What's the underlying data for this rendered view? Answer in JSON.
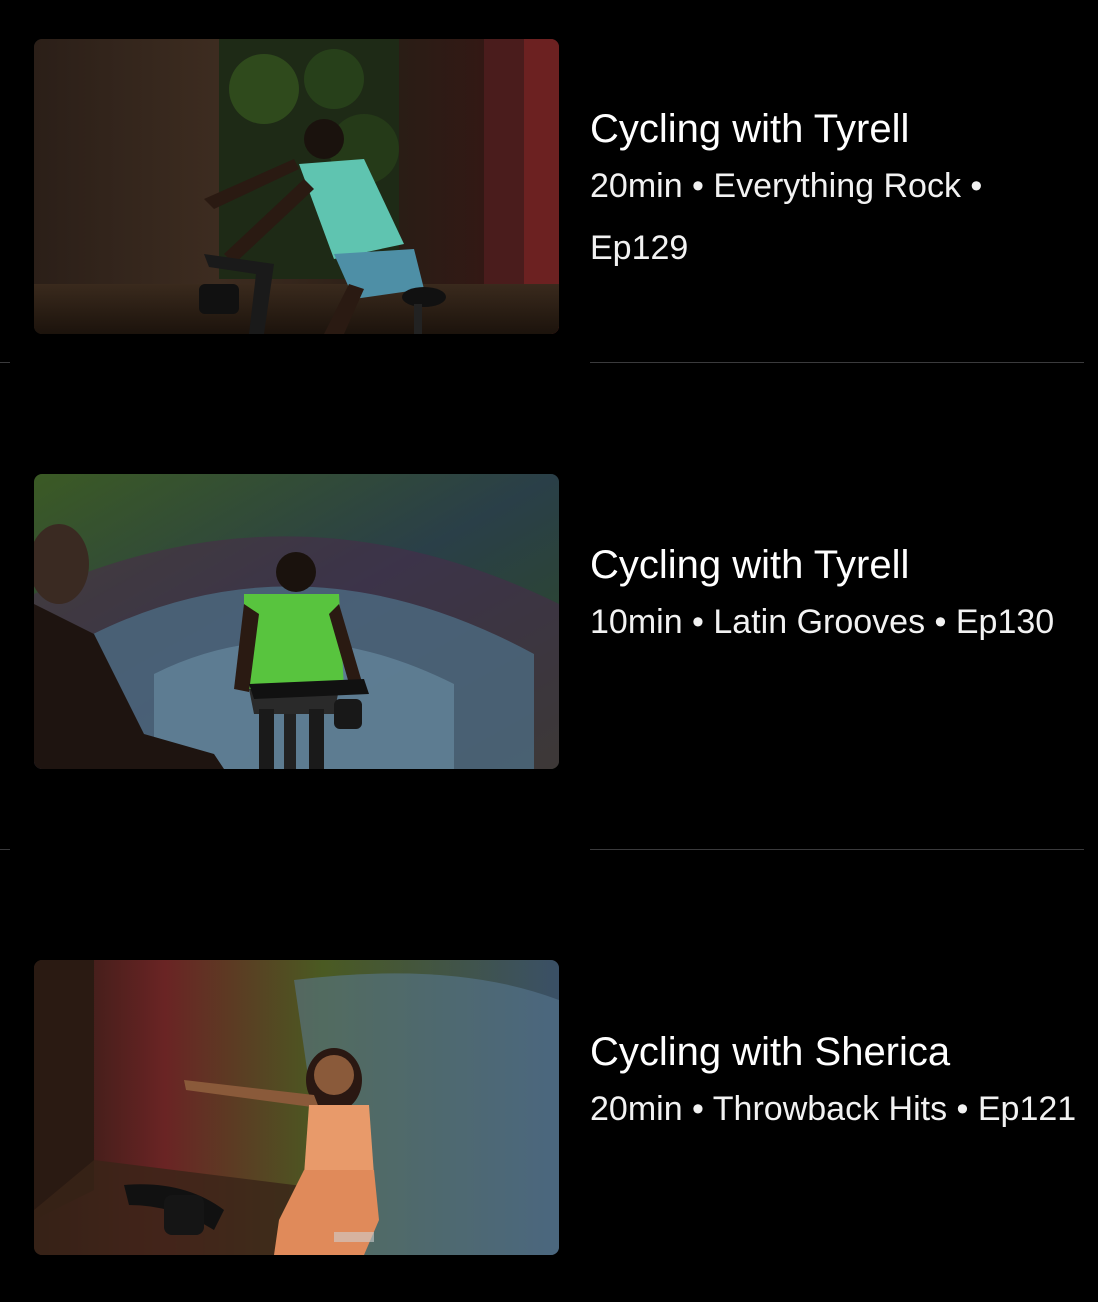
{
  "workouts": [
    {
      "title": "Cycling with Tyrell",
      "meta": "20min • Everything Rock • Ep129"
    },
    {
      "title": "Cycling with Tyrell",
      "meta": "10min • Latin Grooves • Ep130"
    },
    {
      "title": "Cycling with Sherica",
      "meta": "20min • Throwback Hits • Ep121"
    }
  ],
  "colors": {
    "background": "#000000",
    "text": "#ffffff",
    "separator": "#3a3a3c"
  }
}
